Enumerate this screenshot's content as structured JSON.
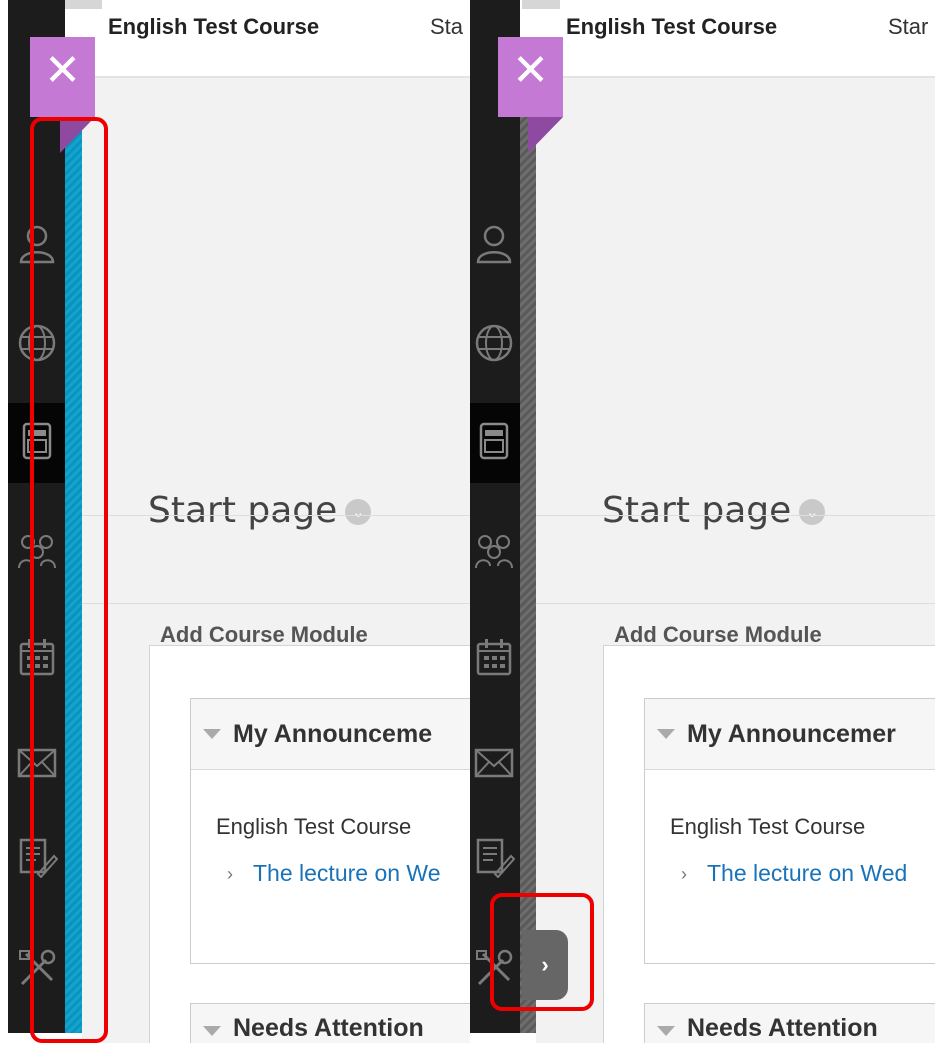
{
  "colors": {
    "accent": "#c47ad4",
    "sidebar": "#1c1c1c",
    "highlight_strip": "#11a4d0",
    "collapsed_strip": "#6d6d6d",
    "link": "#1a73b8",
    "annotation": "#ee0000"
  },
  "left_panel": {
    "close_icon": "✕",
    "course_title": "English Test Course",
    "start_tab_label": "Sta",
    "page_title": "Start page",
    "title_menu_icon": "chevron-down-icon",
    "add_module_label": "Add Course Module",
    "announcements": {
      "title": "My Announceme",
      "course": "English Test Course",
      "arrow": "›",
      "link": "The lecture on We"
    },
    "needs_attention_title": "Needs Attention"
  },
  "right_panel": {
    "close_icon": "✕",
    "course_title": "English Test Course",
    "start_tab_label": "Star",
    "page_title": "Start page",
    "title_menu_icon": "chevron-down-icon",
    "add_module_label": "Add Course Module",
    "announcements": {
      "title": "My Announcemer",
      "course": "English Test Course",
      "arrow": "›",
      "link": "The lecture on Wed"
    },
    "needs_attention_title": "Needs Attention",
    "expand_icon": "›"
  },
  "sidebar_icons": [
    "user-icon",
    "globe-icon",
    "course-icon",
    "groups-icon",
    "calendar-icon",
    "mail-icon",
    "grades-icon",
    "tools-icon"
  ]
}
